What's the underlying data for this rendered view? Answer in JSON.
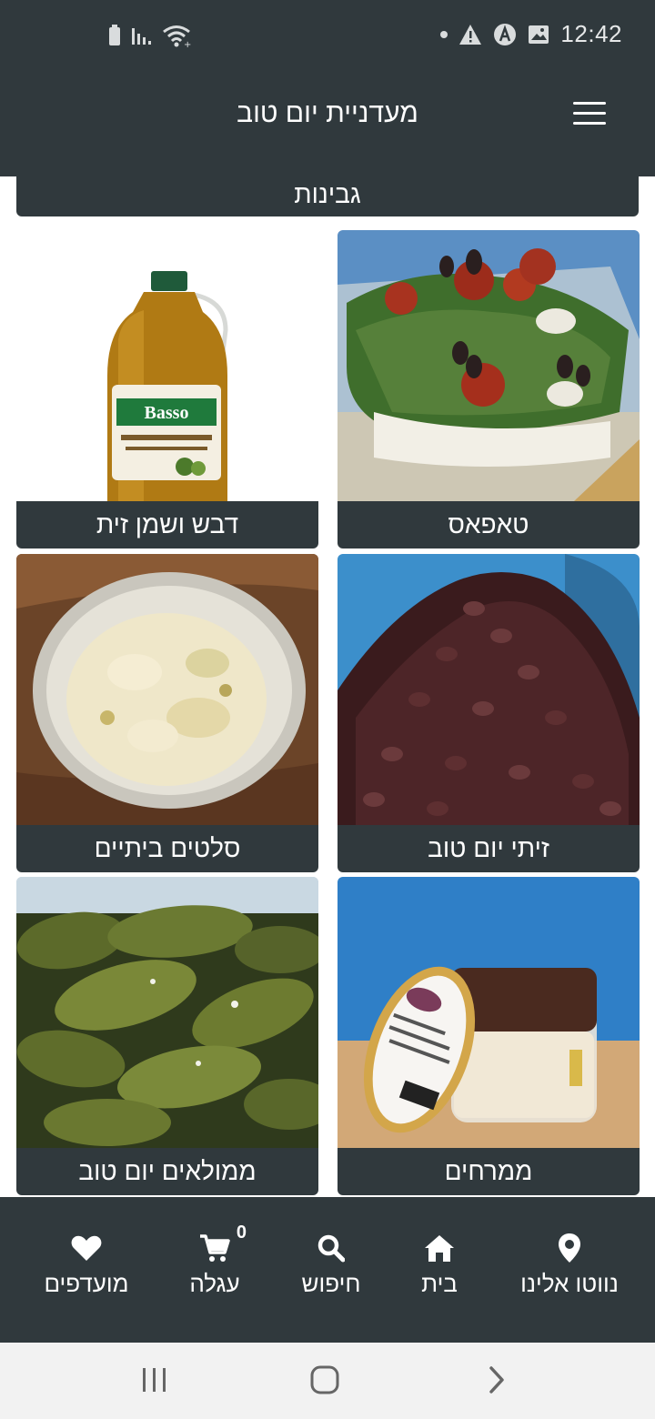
{
  "status_bar": {
    "time": "12:42",
    "left_icons": [
      "battery-icon",
      "signal-icon",
      "wifi-icon"
    ],
    "right_icons": [
      "dot-icon",
      "warning-icon",
      "app-a-icon",
      "image-icon"
    ]
  },
  "app_bar": {
    "title": "מעדניית יום טוב",
    "menu_icon": "hamburger-menu-icon"
  },
  "category_banner": "גבינות",
  "categories": [
    {
      "label": "טאפאס",
      "image": "tapas-image"
    },
    {
      "label": "דבש ושמן זית",
      "image": "olive-oil-image"
    },
    {
      "label": "זיתי יום טוב",
      "image": "olives-image"
    },
    {
      "label": "סלטים ביתיים",
      "image": "homemade-salads-image"
    },
    {
      "label": "ממרחים",
      "image": "spreads-image"
    },
    {
      "label": "ממולאים יום טוב",
      "image": "stuffed-grape-leaves-image"
    }
  ],
  "bottom_nav": {
    "items": [
      {
        "label": "נווטו אלינו",
        "icon": "location-pin-icon"
      },
      {
        "label": "בית",
        "icon": "home-icon"
      },
      {
        "label": "חיפוש",
        "icon": "search-icon"
      },
      {
        "label": "עגלה",
        "icon": "cart-icon",
        "badge": "0"
      },
      {
        "label": "מועדפים",
        "icon": "heart-icon"
      }
    ]
  },
  "system_nav": [
    "recents-icon",
    "home-circle-icon",
    "back-icon"
  ],
  "colors": {
    "bar": "#30393d",
    "text_light": "#ffffff",
    "system_nav_bg": "#f2f2f2"
  }
}
